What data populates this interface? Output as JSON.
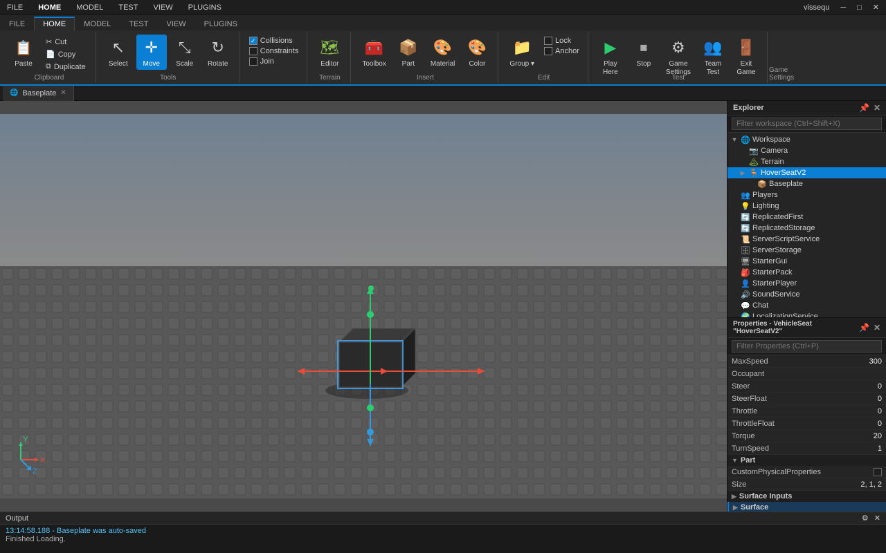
{
  "menubar": {
    "items": [
      "FILE",
      "HOME",
      "MODEL",
      "TEST",
      "VIEW",
      "PLUGINS"
    ],
    "active": "HOME",
    "right": [
      "user_icon",
      "vissequ_label",
      "window_controls"
    ],
    "username": "vissequ"
  },
  "ribbon": {
    "groups": [
      {
        "name": "Clipboard",
        "label": "Clipboard",
        "items_large": [
          {
            "id": "paste",
            "label": "Paste",
            "icon": "📋"
          }
        ],
        "items_small": [
          {
            "id": "cut",
            "label": "Cut",
            "icon": "✂"
          },
          {
            "id": "copy",
            "label": "Copy",
            "icon": "📄"
          },
          {
            "id": "duplicate",
            "label": "Duplicate",
            "icon": "⧉"
          }
        ]
      },
      {
        "name": "Tools",
        "label": "Tools",
        "items_large": [
          {
            "id": "select",
            "label": "Select",
            "icon": "↖"
          },
          {
            "id": "move",
            "label": "Move",
            "icon": "✛",
            "active": true
          },
          {
            "id": "scale",
            "label": "Scale",
            "icon": "⤡"
          },
          {
            "id": "rotate",
            "label": "Rotate",
            "icon": "↻"
          }
        ]
      },
      {
        "name": "Terrain",
        "label": "Terrain",
        "items_large": [
          {
            "id": "editor",
            "label": "Editor",
            "icon": "🗺"
          }
        ]
      },
      {
        "name": "Insert",
        "label": "Insert",
        "items_large": [
          {
            "id": "toolbox",
            "label": "Toolbox",
            "icon": "🧰"
          },
          {
            "id": "part",
            "label": "Part",
            "icon": "📦"
          },
          {
            "id": "material",
            "label": "Material",
            "icon": "🎨"
          },
          {
            "id": "color",
            "label": "Color",
            "icon": "🎨"
          }
        ]
      },
      {
        "name": "Edit",
        "label": "Edit",
        "checkboxes": [
          {
            "id": "lock",
            "label": "Lock",
            "checked": false
          },
          {
            "id": "anchor",
            "label": "Anchor",
            "checked": false
          }
        ],
        "items_large": [
          {
            "id": "group",
            "label": "Group ▾",
            "icon": "📁"
          }
        ]
      },
      {
        "name": "Test",
        "label": "Test",
        "items_large": [
          {
            "id": "play_here",
            "label": "Play Here",
            "icon": "▶",
            "active": false
          },
          {
            "id": "stop",
            "label": "Stop",
            "icon": "⏹"
          },
          {
            "id": "game_settings",
            "label": "Game Settings",
            "icon": "⚙"
          },
          {
            "id": "team_test",
            "label": "Team Test",
            "icon": "👥"
          },
          {
            "id": "exit_game",
            "label": "Exit Game",
            "icon": "🚪"
          }
        ]
      },
      {
        "name": "GameSettings",
        "label": "Game Settings",
        "items_large": []
      }
    ],
    "collisions_checked": true,
    "constraints_checked": false,
    "join_checked": false
  },
  "tab_bar": {
    "tabs": [
      {
        "id": "baseplate",
        "label": "Baseplate",
        "active": true,
        "closeable": true
      }
    ]
  },
  "explorer": {
    "title": "Explorer",
    "filter_placeholder": "Filter workspace (Ctrl+Shift+X)",
    "tree": [
      {
        "id": "workspace",
        "label": "Workspace",
        "icon": "workspace",
        "indent": 0,
        "expanded": true,
        "arrow": "▼"
      },
      {
        "id": "camera",
        "label": "Camera",
        "icon": "camera",
        "indent": 1,
        "expanded": false,
        "arrow": ""
      },
      {
        "id": "terrain",
        "label": "Terrain",
        "icon": "terrain",
        "indent": 1,
        "expanded": false,
        "arrow": ""
      },
      {
        "id": "hoverseav2",
        "label": "HoverSeatV2",
        "icon": "seat",
        "indent": 1,
        "expanded": false,
        "arrow": "▶",
        "selected": true
      },
      {
        "id": "baseplate",
        "label": "Baseplate",
        "icon": "part",
        "indent": 2,
        "expanded": false,
        "arrow": ""
      },
      {
        "id": "players",
        "label": "Players",
        "icon": "players",
        "indent": 0,
        "expanded": false,
        "arrow": ""
      },
      {
        "id": "lighting",
        "label": "Lighting",
        "icon": "lighting",
        "indent": 0,
        "expanded": false,
        "arrow": ""
      },
      {
        "id": "replicatedfirst",
        "label": "ReplicatedFirst",
        "icon": "replicated",
        "indent": 0,
        "expanded": false,
        "arrow": ""
      },
      {
        "id": "replicatedstorage",
        "label": "ReplicatedStorage",
        "icon": "replicated",
        "indent": 0,
        "expanded": false,
        "arrow": ""
      },
      {
        "id": "serverscriptservice",
        "label": "ServerScriptService",
        "icon": "script",
        "indent": 0,
        "expanded": false,
        "arrow": ""
      },
      {
        "id": "serverstorage",
        "label": "ServerStorage",
        "icon": "storage",
        "indent": 0,
        "expanded": false,
        "arrow": ""
      },
      {
        "id": "startergui",
        "label": "StarterGui",
        "icon": "gui",
        "indent": 0,
        "expanded": false,
        "arrow": ""
      },
      {
        "id": "starterpack",
        "label": "StarterPack",
        "icon": "pack",
        "indent": 0,
        "expanded": false,
        "arrow": ""
      },
      {
        "id": "starterplayer",
        "label": "StarterPlayer",
        "icon": "player",
        "indent": 0,
        "expanded": false,
        "arrow": ""
      },
      {
        "id": "soundservice",
        "label": "SoundService",
        "icon": "sound",
        "indent": 0,
        "expanded": false,
        "arrow": ""
      },
      {
        "id": "chat",
        "label": "Chat",
        "icon": "chat",
        "indent": 0,
        "expanded": false,
        "arrow": ""
      },
      {
        "id": "localizationservice",
        "label": "LocalizationService",
        "icon": "localize",
        "indent": 0,
        "expanded": false,
        "arrow": ""
      }
    ]
  },
  "properties": {
    "title": "Properties - VehicleSeat \"HoverSeatV2\"",
    "filter_placeholder": "Filter Properties (Ctrl+P)",
    "rows": [
      {
        "id": "maxspeed",
        "name": "MaxSpeed",
        "value": "300",
        "type": "number"
      },
      {
        "id": "occupant",
        "name": "Occupant",
        "value": "",
        "type": "text"
      },
      {
        "id": "steer",
        "name": "Steer",
        "value": "0",
        "type": "number"
      },
      {
        "id": "steerfloat",
        "name": "SteerFloat",
        "value": "0",
        "type": "number"
      },
      {
        "id": "throttle",
        "name": "Throttle",
        "value": "0",
        "type": "number"
      },
      {
        "id": "throttlefloat",
        "name": "ThrottleFloat",
        "value": "0",
        "type": "number"
      },
      {
        "id": "torque",
        "name": "Torque",
        "value": "20",
        "type": "number"
      },
      {
        "id": "turnspeed",
        "name": "TurnSpeed",
        "value": "1",
        "type": "number"
      }
    ],
    "sections": [
      {
        "id": "part",
        "label": "Part"
      },
      {
        "id": "surface_inputs",
        "label": "Surface Inputs"
      },
      {
        "id": "surface",
        "label": "Surface",
        "expanded": false
      }
    ],
    "part_rows": [
      {
        "id": "customphysicalprops",
        "name": "CustomPhysicalProperties",
        "value": "checkbox",
        "type": "checkbox"
      },
      {
        "id": "size",
        "name": "Size",
        "value": "2, 1, 2",
        "type": "text"
      }
    ]
  },
  "output": {
    "title": "Output",
    "logs": [
      {
        "id": "log1",
        "text": "13:14:58.188 - Baseplate was auto-saved",
        "type": "save"
      },
      {
        "id": "log2",
        "text": "Finished Loading.",
        "type": "normal"
      }
    ]
  },
  "icons": {
    "workspace_icon": "🌐",
    "camera_icon": "📷",
    "terrain_icon": "🏔",
    "seat_icon": "🪑",
    "part_icon": "📦",
    "players_icon": "👥",
    "lighting_icon": "💡",
    "replicated_icon": "🔄",
    "script_icon": "📜",
    "storage_icon": "🗄",
    "gui_icon": "🖥",
    "pack_icon": "🎒",
    "player_icon": "👤",
    "sound_icon": "🔊",
    "chat_icon": "💬",
    "localize_icon": "🌍"
  },
  "scene": {
    "bg_color": "#4a5568",
    "grid_color": "#3d3d3d",
    "axis_colors": {
      "x": "#e74c3c",
      "y": "#2ecc71",
      "z": "#3498db"
    }
  }
}
